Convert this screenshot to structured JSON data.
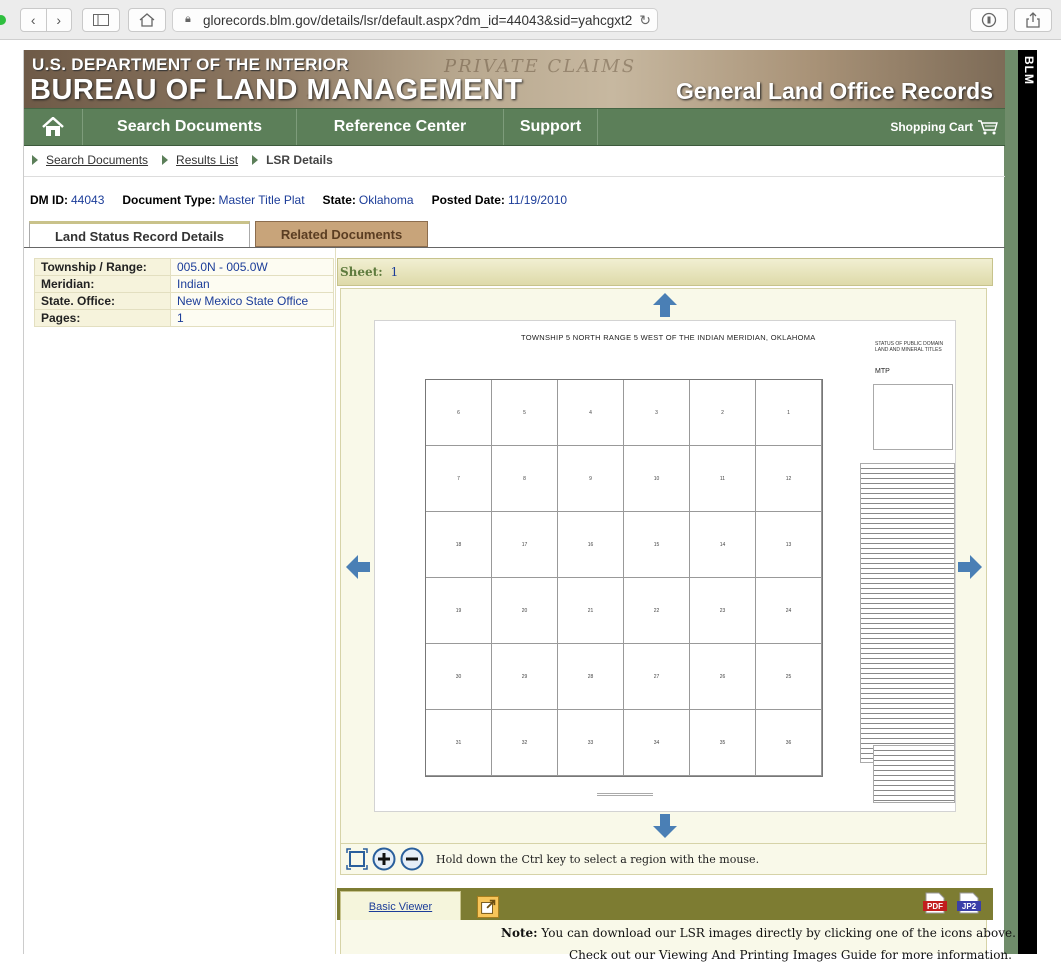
{
  "browser": {
    "url": "glorecords.blm.gov/details/lsr/default.aspx?dm_id=44043&sid=yahcgxt2"
  },
  "header": {
    "department": "U.S. DEPARTMENT OF THE INTERIOR",
    "bureau": "BUREAU OF LAND MANAGEMENT",
    "site_title": "General Land Office Records",
    "background_text": "PRIVATE CLAIMS",
    "side_label": "BLM"
  },
  "nav": {
    "items": [
      "Search Documents",
      "Reference Center",
      "Support"
    ],
    "cart_label": "Shopping Cart"
  },
  "breadcrumb": {
    "items": [
      "Search Documents",
      "Results List"
    ],
    "current": "LSR Details"
  },
  "meta": {
    "dm_id_label": "DM ID:",
    "dm_id": "44043",
    "doc_type_label": "Document Type:",
    "doc_type": "Master Title Plat",
    "state_label": "State:",
    "state": "Oklahoma",
    "posted_label": "Posted Date:",
    "posted": "11/19/2010"
  },
  "tabs": {
    "active": "Land Status Record Details",
    "other": "Related Documents"
  },
  "details": {
    "rows": [
      {
        "label": "Township / Range:",
        "value": "005.0N - 005.0W"
      },
      {
        "label": "Meridian:",
        "value": "Indian"
      },
      {
        "label": "State. Office:",
        "value": "New Mexico State Office"
      },
      {
        "label": "Pages:",
        "value": "1"
      }
    ]
  },
  "viewer": {
    "sheet_label": "Sheet:",
    "sheet_value": "1",
    "hint": "Hold down the Ctrl key to select a region with the mouse.",
    "plat": {
      "title": "TOWNSHIP  5  NORTH    RANGE  5  WEST   OF THE      INDIAN        MERIDIAN, OKLAHOMA",
      "status": "STATUS OF PUBLIC DOMAIN LAND AND MINERAL TITLES",
      "mtp": "MTP",
      "sections": [
        "6",
        "5",
        "4",
        "3",
        "2",
        "1",
        "7",
        "8",
        "9",
        "10",
        "11",
        "12",
        "18",
        "17",
        "16",
        "15",
        "14",
        "13",
        "19",
        "20",
        "21",
        "22",
        "23",
        "24",
        "30",
        "29",
        "28",
        "27",
        "26",
        "25",
        "31",
        "32",
        "33",
        "34",
        "35",
        "36"
      ]
    }
  },
  "bottom": {
    "basic_viewer": "Basic Viewer",
    "pdf_label": "PDF",
    "jp2_label": "JP2",
    "note_label": "Note:",
    "note_text": "You can download our LSR images directly by clicking one of the icons above.",
    "note2_text": "Check out our Viewing And Printing Images Guide for more information."
  }
}
